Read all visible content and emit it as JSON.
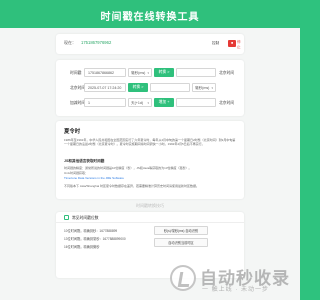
{
  "header": {
    "title": "时间戳在线转换工具"
  },
  "now": {
    "label": "现在：",
    "timestamp": "1751867976962",
    "stop_label": "控制",
    "stop_icon_text": "■",
    "stop_text": "停止"
  },
  "converter": {
    "row1": {
      "label": "时间戳",
      "input": "1751867866862",
      "unit": "毫秒(ms)",
      "button": "转换 >",
      "output": "",
      "right_label": "北京时间"
    },
    "row2": {
      "label": "北京时间",
      "input": "2025-07-07 17:24:20",
      "button": "转换 >",
      "output": "",
      "unit": "毫秒(ms)"
    },
    "row3": {
      "label": "加减时间",
      "input": "1",
      "unit": "天(+1d)",
      "button": "增加 +",
      "output": "",
      "right_label": "北京时间"
    }
  },
  "info": {
    "title": "夏令时",
    "para1": "1986年至1991年，中华人民共和国在全国范围实行了六年夏令时，每年从4月中旬的第一个星期日2时整（北京时间）到9月中旬第一个星期日的凌晨2时整（北京夏令时）。夏令时实施期间将时间调快一小时。1992年4月5日后不再实行。",
    "subtitle": "JS和其他语言获取时间戳",
    "para2": "时间戳的精度：通常所说的时间戳是10位精度（秒），JS和Java等获取的为13位精度（毫秒）。",
    "para3": "Unix时间戳获取：",
    "link": "Timezone Data Versions in the JRE Software",
    "para4": "不同版本下 Asia/Shanghai 时区夏令时数据存在差异，若需要精准计算历史时间请使用最新时区数据。"
  },
  "section_caption": "时间戳转换技巧",
  "tips": {
    "title": "常见时间戳位数",
    "items": [
      "10位时间戳，精确到秒：1677888899",
      "13位时间戳，精确到毫秒：1677888899000",
      "16位时间戳，精确到微秒"
    ],
    "buttons": [
      "秒(s)/毫秒(ms) 自动识别",
      "自动识别当前时区"
    ]
  },
  "watermark": {
    "big": "自动秒收录",
    "small": "一 触上线 · 未动一步"
  }
}
